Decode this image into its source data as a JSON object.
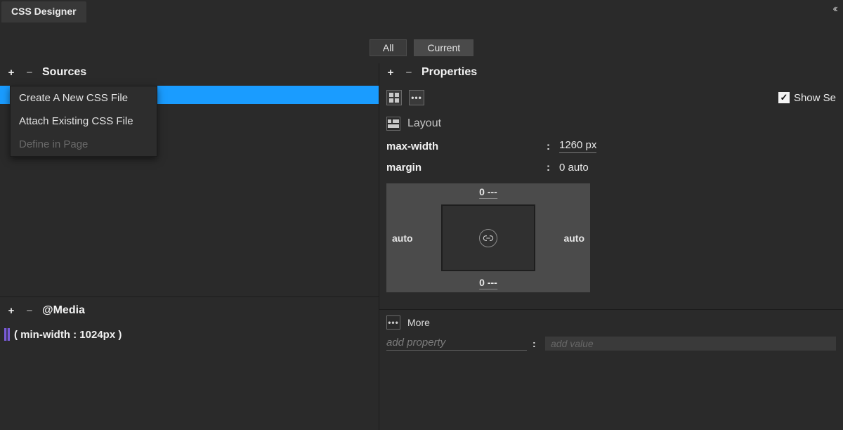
{
  "panelTitle": "CSS Designer",
  "collapse": "‹‹",
  "tabs": {
    "all": "All",
    "current": "Current"
  },
  "sources": {
    "heading": "Sources",
    "menu": {
      "createNew": "Create A New CSS File",
      "attachExisting": "Attach Existing CSS File",
      "defineInPage": "Define in Page"
    }
  },
  "media": {
    "heading": "@Media",
    "query": "( min-width : 1024px )"
  },
  "properties": {
    "heading": "Properties",
    "showSetLabel": "Show Se",
    "layout": {
      "title": "Layout",
      "maxWidth": {
        "key": "max-width",
        "value": "1260 px"
      },
      "margin": {
        "key": "margin",
        "value": "0 auto",
        "box": {
          "top": "0 ---",
          "right": "auto",
          "bottom": "0 ---",
          "left": "auto"
        }
      }
    },
    "more": {
      "title": "More",
      "addPropertyPlaceholder": "add property",
      "addValuePlaceholder": "add value"
    }
  },
  "glyphs": {
    "plus": "+",
    "minus": "−",
    "colon": ":"
  }
}
